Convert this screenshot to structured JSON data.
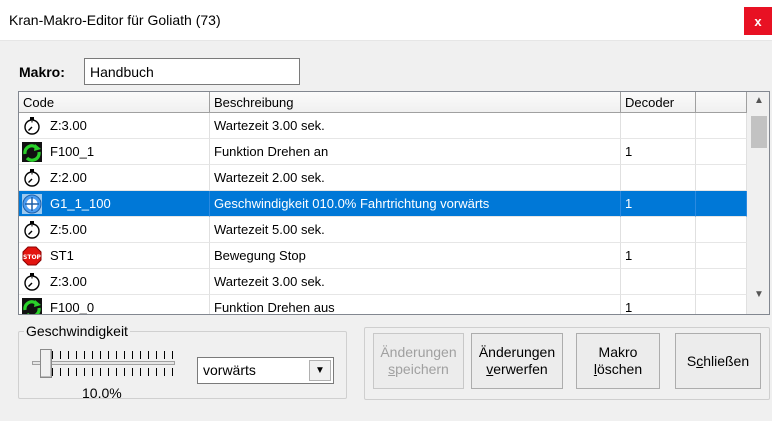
{
  "window": {
    "title": "Kran-Makro-Editor für Goliath  (73)",
    "close_label": "x"
  },
  "macro": {
    "label": "Makro:",
    "value": "Handbuch"
  },
  "grid": {
    "columns": [
      "Code",
      "Beschreibung",
      "Decoder",
      ""
    ],
    "rows": [
      {
        "icon": "stopwatch-icon",
        "code": "Z:3.00",
        "desc": "Wartezeit 3.00 sek.",
        "decoder": "",
        "selected": false
      },
      {
        "icon": "rotate-function-icon",
        "code": "F100_1",
        "desc": "Funktion Drehen an",
        "decoder": "1",
        "selected": false
      },
      {
        "icon": "stopwatch-icon",
        "code": "Z:2.00",
        "desc": "Wartezeit 2.00 sek.",
        "decoder": "",
        "selected": false
      },
      {
        "icon": "speed-direction-icon",
        "code": "G1_1_100",
        "desc": "Geschwindigkeit 010.0% Fahrtrichtung vorwärts",
        "decoder": "1",
        "selected": true
      },
      {
        "icon": "stopwatch-icon",
        "code": "Z:5.00",
        "desc": "Wartezeit 5.00 sek.",
        "decoder": "",
        "selected": false
      },
      {
        "icon": "stop-sign-icon",
        "code": "ST1",
        "desc": "Bewegung Stop",
        "decoder": "1",
        "selected": false
      },
      {
        "icon": "stopwatch-icon",
        "code": "Z:3.00",
        "desc": "Wartezeit 3.00 sek.",
        "decoder": "",
        "selected": false
      },
      {
        "icon": "rotate-function-icon",
        "code": "F100_0",
        "desc": "Funktion Drehen aus",
        "decoder": "1",
        "selected": false
      }
    ],
    "scroll_position": 0.05
  },
  "speed": {
    "group_label": "Geschwindigkeit",
    "value_label": "10.0%",
    "value": 0.1,
    "direction": "vorwärts"
  },
  "buttons": {
    "save": {
      "line1": "Änderungen",
      "line2_pre": "",
      "line2_u": "s",
      "line2_post": "peichern",
      "enabled": false
    },
    "discard": {
      "line1": "Änderungen",
      "line2_pre": "",
      "line2_u": "v",
      "line2_post": "erwerfen",
      "enabled": true
    },
    "delete": {
      "line1": "Makro",
      "line2_pre": "",
      "line2_u": "l",
      "line2_post": "öschen",
      "enabled": true
    },
    "close": {
      "pre": "S",
      "u": "c",
      "post": "hließen",
      "enabled": true
    }
  },
  "colors": {
    "selection": "#0078d7",
    "close_button": "#e81123"
  }
}
